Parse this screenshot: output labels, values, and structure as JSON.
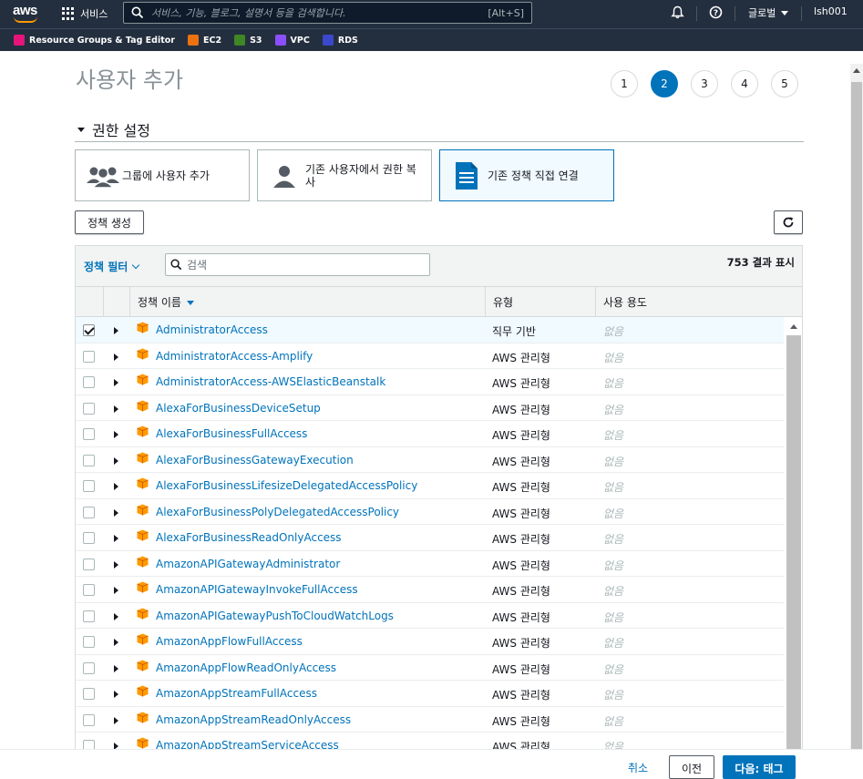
{
  "topnav": {
    "logo": "aws",
    "services_label": "서비스",
    "search_placeholder": "서비스, 기능, 블로그, 설명서 등을 검색합니다.",
    "search_shortcut": "[Alt+S]",
    "region_label": "글로벌",
    "user_label": "lsh001",
    "icons": [
      "grid-icon",
      "search-icon",
      "bell-icon",
      "help-icon"
    ]
  },
  "bookmarks": [
    {
      "label": "Resource Groups & Tag Editor",
      "color": "#e7157b"
    },
    {
      "label": "EC2",
      "color": "#ec7211"
    },
    {
      "label": "S3",
      "color": "#3f8624"
    },
    {
      "label": "VPC",
      "color": "#8c4fff"
    },
    {
      "label": "RDS",
      "color": "#3b48cc"
    }
  ],
  "page": {
    "title": "사용자 추가",
    "steps": [
      "1",
      "2",
      "3",
      "4",
      "5"
    ],
    "active_step": "2",
    "section_title": "권한 설정"
  },
  "options": {
    "group": "그룹에 사용자 추가",
    "copy": "기존 사용자에서 권한 복사",
    "attach": "기존 정책 직접 연결"
  },
  "actions": {
    "create_policy": "정책 생성"
  },
  "table": {
    "filter_label": "정책 필터",
    "search_placeholder": "검색",
    "result_count": "753 결과 표시",
    "headers": {
      "name": "정책 이름",
      "type": "유형",
      "usage": "사용 용도"
    },
    "rows": [
      {
        "name": "AdministratorAccess",
        "type": "직무 기반",
        "usage": "없음",
        "checked": true
      },
      {
        "name": "AdministratorAccess-Amplify",
        "type": "AWS 관리형",
        "usage": "없음",
        "checked": false
      },
      {
        "name": "AdministratorAccess-AWSElasticBeanstalk",
        "type": "AWS 관리형",
        "usage": "없음",
        "checked": false
      },
      {
        "name": "AlexaForBusinessDeviceSetup",
        "type": "AWS 관리형",
        "usage": "없음",
        "checked": false
      },
      {
        "name": "AlexaForBusinessFullAccess",
        "type": "AWS 관리형",
        "usage": "없음",
        "checked": false
      },
      {
        "name": "AlexaForBusinessGatewayExecution",
        "type": "AWS 관리형",
        "usage": "없음",
        "checked": false
      },
      {
        "name": "AlexaForBusinessLifesizeDelegatedAccessPolicy",
        "type": "AWS 관리형",
        "usage": "없음",
        "checked": false
      },
      {
        "name": "AlexaForBusinessPolyDelegatedAccessPolicy",
        "type": "AWS 관리형",
        "usage": "없음",
        "checked": false
      },
      {
        "name": "AlexaForBusinessReadOnlyAccess",
        "type": "AWS 관리형",
        "usage": "없음",
        "checked": false
      },
      {
        "name": "AmazonAPIGatewayAdministrator",
        "type": "AWS 관리형",
        "usage": "없음",
        "checked": false
      },
      {
        "name": "AmazonAPIGatewayInvokeFullAccess",
        "type": "AWS 관리형",
        "usage": "없음",
        "checked": false
      },
      {
        "name": "AmazonAPIGatewayPushToCloudWatchLogs",
        "type": "AWS 관리형",
        "usage": "없음",
        "checked": false
      },
      {
        "name": "AmazonAppFlowFullAccess",
        "type": "AWS 관리형",
        "usage": "없음",
        "checked": false
      },
      {
        "name": "AmazonAppFlowReadOnlyAccess",
        "type": "AWS 관리형",
        "usage": "없음",
        "checked": false
      },
      {
        "name": "AmazonAppStreamFullAccess",
        "type": "AWS 관리형",
        "usage": "없음",
        "checked": false
      },
      {
        "name": "AmazonAppStreamReadOnlyAccess",
        "type": "AWS 관리형",
        "usage": "없음",
        "checked": false
      },
      {
        "name": "AmazonAppStreamServiceAccess",
        "type": "AWS 관리형",
        "usage": "없음",
        "checked": false
      }
    ]
  },
  "footer": {
    "cancel": "취소",
    "previous": "이전",
    "next": "다음: 태그"
  },
  "colors": {
    "nav_bg": "#232f3e",
    "accent": "#0073bb",
    "aws_orange": "#ff9900",
    "policy_icon": "#f90"
  }
}
